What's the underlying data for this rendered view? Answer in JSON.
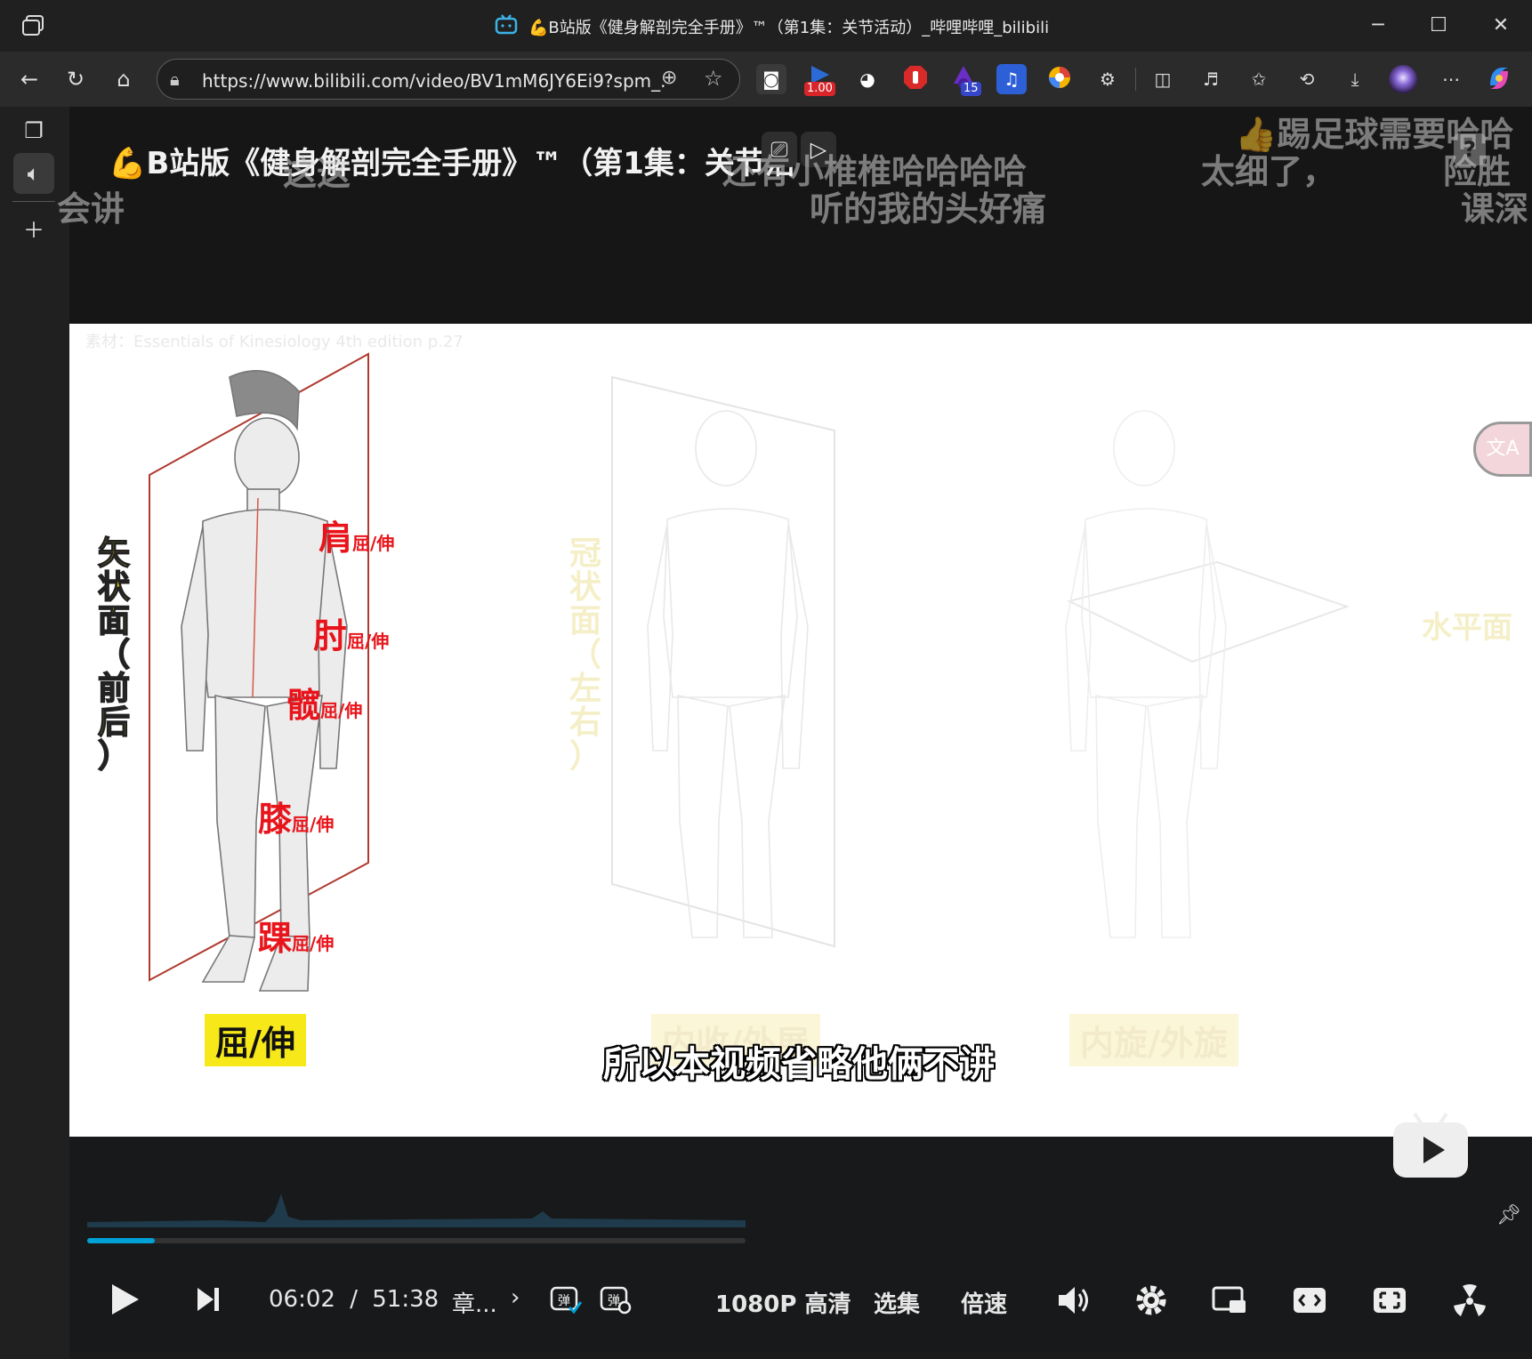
{
  "window": {
    "title": "💪B站版《健身解剖完全手册》™（第1集：关节活动）_哔哩哔哩_bilibili",
    "tab_icon": "bilibili-tv-icon"
  },
  "nav": {
    "url": "https://www.bilibili.com/video/BV1mM6JY6Ei9?spm_...",
    "extension_badges": {
      "speed": "1.00",
      "count": "15"
    }
  },
  "video": {
    "title": "💪B站版《健身解剖完全手册》™（第1集：关节活",
    "danmaku": [
      "👍踢足球需要哈哈",
      "还有小椎椎哈哈哈哈",
      "太细了，",
      "险胜",
      "听的我的头好痛",
      "课深",
      "这这",
      "会讲"
    ],
    "frame": {
      "source_note": "素材：Essentials of Kinesiology 4th edition p.27",
      "planes": [
        {
          "label": "矢状面（前后）",
          "movement": "屈/伸",
          "label_color": "#f0d010"
        },
        {
          "label": "冠状面（左右）",
          "movement": "内收/外展",
          "label_color": "#f5efc8"
        },
        {
          "label": "水平面",
          "movement": "内旋/外旋",
          "label_color": "#f5efc8"
        }
      ],
      "joints": [
        {
          "name": "肩",
          "motion": "屈/伸"
        },
        {
          "name": "肘",
          "motion": "屈/伸"
        },
        {
          "name": "髋",
          "motion": "屈/伸"
        },
        {
          "name": "膝",
          "motion": "屈/伸"
        },
        {
          "name": "踝",
          "motion": "屈/伸"
        }
      ],
      "subtitle": "所以本视频省略他俩不讲"
    },
    "controls": {
      "current_time": "06:02",
      "separator": "/",
      "duration": "51:38",
      "chapter": "章...",
      "quality": "1080P 高清",
      "episodes": "选集",
      "speed": "倍速",
      "progress_fraction": 0.103
    },
    "colors": {
      "accent": "#00a1d6",
      "joint_red": "#e8141b",
      "plane_line": "#b03a2e"
    }
  }
}
